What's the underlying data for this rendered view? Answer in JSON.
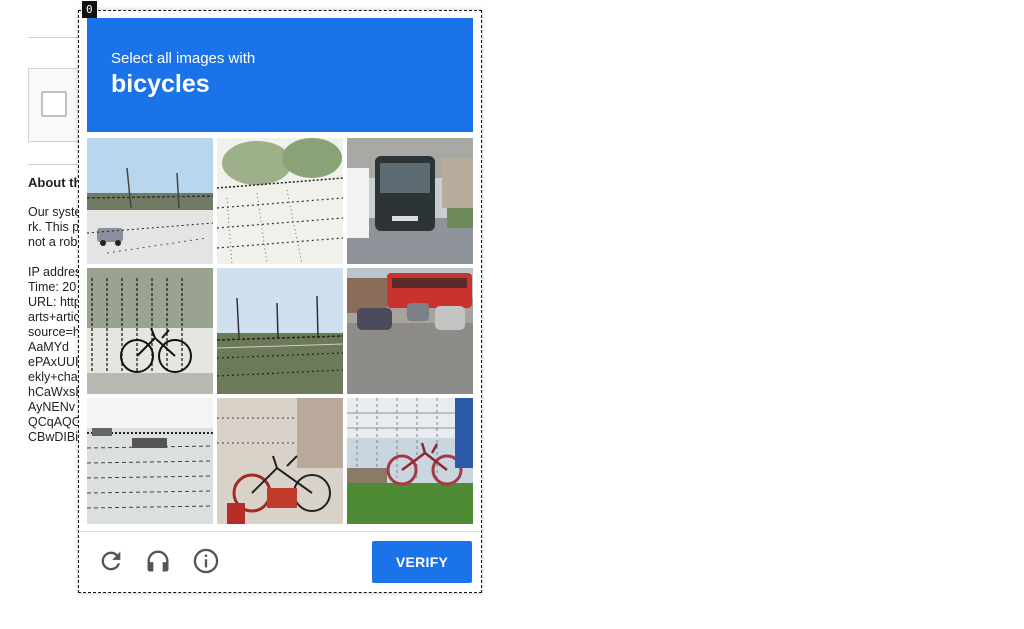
{
  "frame": {
    "id_label": "0"
  },
  "background": {
    "about_title": "About th",
    "lines": [
      "Our syste",
      "rk. This p",
      "not a rob",
      "",
      "IP addres",
      "Time: 20",
      "URL: http",
      "arts+artic",
      "source=h",
      "AaMYd",
      "ePAxUUI",
      "ekly+cha",
      "hCaWxsI",
      "AyNENv",
      "QCqAQC",
      "CBwDIBi"
    ]
  },
  "captcha": {
    "instruction": "Select all images with",
    "target": "bicycles",
    "verify_label": "VERIFY",
    "header_color": "#1a73e8",
    "tiles": [
      {
        "scene": "highway-car",
        "row": 1,
        "col": 1
      },
      {
        "scene": "railway-trees",
        "row": 1,
        "col": 2
      },
      {
        "scene": "bus-road",
        "row": 1,
        "col": 3
      },
      {
        "scene": "bicycle-fence",
        "row": 2,
        "col": 1
      },
      {
        "scene": "railway-sky",
        "row": 2,
        "col": 2
      },
      {
        "scene": "red-bus-cars",
        "row": 2,
        "col": 3
      },
      {
        "scene": "harbor-water",
        "row": 3,
        "col": 1
      },
      {
        "scene": "bicycles-parked",
        "row": 3,
        "col": 2
      },
      {
        "scene": "red-bicycle-grass",
        "row": 3,
        "col": 3
      }
    ],
    "icons": [
      "reload-icon",
      "headphones-icon",
      "info-icon"
    ]
  }
}
